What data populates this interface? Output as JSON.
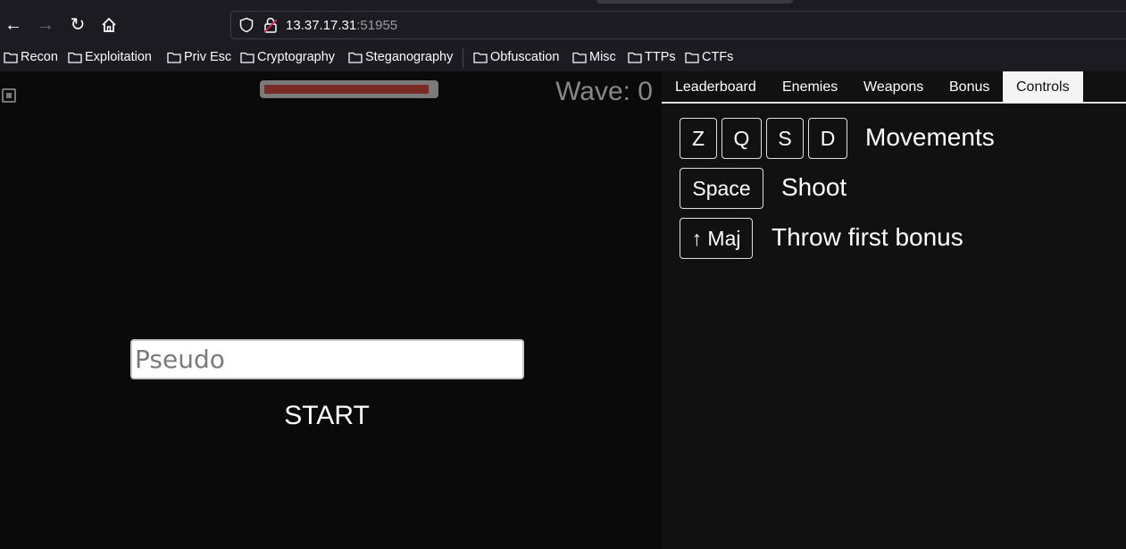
{
  "browser": {
    "url_host": "13.37.17.31",
    "url_port": ":51955",
    "bookmarks": [
      "Recon",
      "Exploitation",
      "Priv Esc",
      "Cryptography",
      "Steganography",
      "Obfuscation",
      "Misc",
      "TTPs",
      "CTFs"
    ]
  },
  "game": {
    "wave_label": "Wave: 0",
    "health_fraction": 0.97,
    "pseudo_placeholder": "Pseudo",
    "pseudo_value": "",
    "start_label": "START"
  },
  "panel": {
    "tabs": [
      "Leaderboard",
      "Enemies",
      "Weapons",
      "Bonus",
      "Controls"
    ],
    "active_tab": "Controls",
    "controls": [
      {
        "keys": [
          "Z",
          "Q",
          "S",
          "D"
        ],
        "action": "Movements"
      },
      {
        "keys": [
          "Space"
        ],
        "action": "Shoot"
      },
      {
        "keys": [
          "↑ Maj"
        ],
        "action": "Throw first bonus"
      }
    ]
  },
  "colors": {
    "health_fill": "#7a2a24",
    "active_tab_bg": "#f4f4f4"
  }
}
